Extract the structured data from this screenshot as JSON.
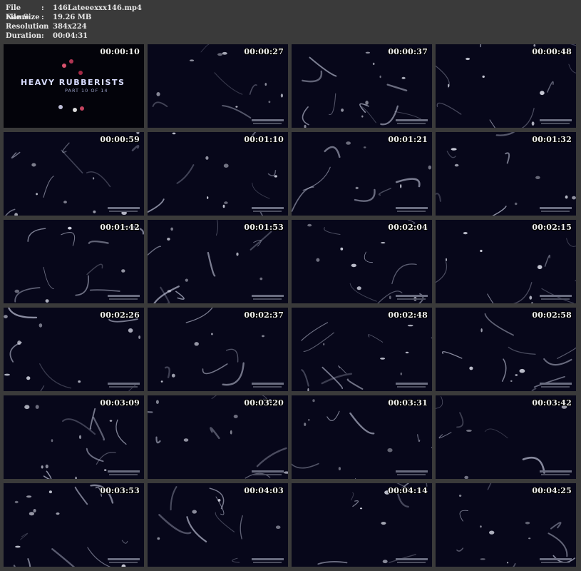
{
  "meta": [
    {
      "key": "File Name",
      "sep": ":",
      "value": "146Lateeexxx146.mp4"
    },
    {
      "key": "File Size",
      "sep": ":",
      "value": "19.26 MB"
    },
    {
      "key": "Resolution",
      "sep": ":",
      "value": "384x224"
    },
    {
      "key": "Duration",
      "sep": ":",
      "value": "00:04:31"
    }
  ],
  "thumbnails": [
    {
      "time": "00:00:10"
    },
    {
      "time": "00:00:27"
    },
    {
      "time": "00:00:37"
    },
    {
      "time": "00:00:48"
    },
    {
      "time": "00:00:59"
    },
    {
      "time": "00:01:10"
    },
    {
      "time": "00:01:21"
    },
    {
      "time": "00:01:32"
    },
    {
      "time": "00:01:42"
    },
    {
      "time": "00:01:53"
    },
    {
      "time": "00:02:04"
    },
    {
      "time": "00:02:15"
    },
    {
      "time": "00:02:26"
    },
    {
      "time": "00:02:37"
    },
    {
      "time": "00:02:48"
    },
    {
      "time": "00:02:58"
    },
    {
      "time": "00:03:09"
    },
    {
      "time": "00:03:20"
    },
    {
      "time": "00:03:31"
    },
    {
      "time": "00:03:42"
    },
    {
      "time": "00:03:53"
    },
    {
      "time": "00:04:03"
    },
    {
      "time": "00:04:14"
    },
    {
      "time": "00:04:25"
    }
  ],
  "first_frame_title": {
    "title": "HEAVY RUBBERISTS",
    "subtitle": "PART 10 OF 14"
  },
  "colors": {
    "background": "#3a3a3a",
    "text": "#e8e8e8",
    "frame": "#05050d",
    "highlight": "#c8cce0"
  }
}
